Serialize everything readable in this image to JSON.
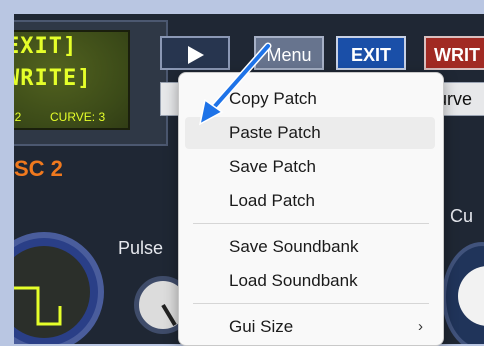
{
  "lcd": {
    "line1": "EXIT]",
    "line2": "WRITE]",
    "left_small": ": 2",
    "curve_label": "CURVE: 3"
  },
  "toolbar": {
    "play_icon": "play-icon",
    "menu_label": "Menu",
    "exit_label": "EXIT",
    "write_label": "WRIT",
    "curve_field": "urve"
  },
  "synth": {
    "osc_label": "SC 2",
    "pulse_label": "Pulse",
    "cu_label": "Cu"
  },
  "context_menu": {
    "items": [
      {
        "label": "Copy Patch"
      },
      {
        "label": "Paste Patch"
      },
      {
        "label": "Save Patch"
      },
      {
        "label": "Load Patch"
      },
      {
        "label": "Save Soundbank"
      },
      {
        "label": "Load Soundbank"
      },
      {
        "label": "Gui Size",
        "submenu_icon": "chevron-right-icon"
      }
    ],
    "hovered_index": 1
  },
  "colors": {
    "lcd_text": "#e5ff2a",
    "osc_label": "#f0791e",
    "exit_button": "#1a4fa8",
    "write_button": "#a12a23",
    "annotation_arrow": "#1e73e8"
  }
}
